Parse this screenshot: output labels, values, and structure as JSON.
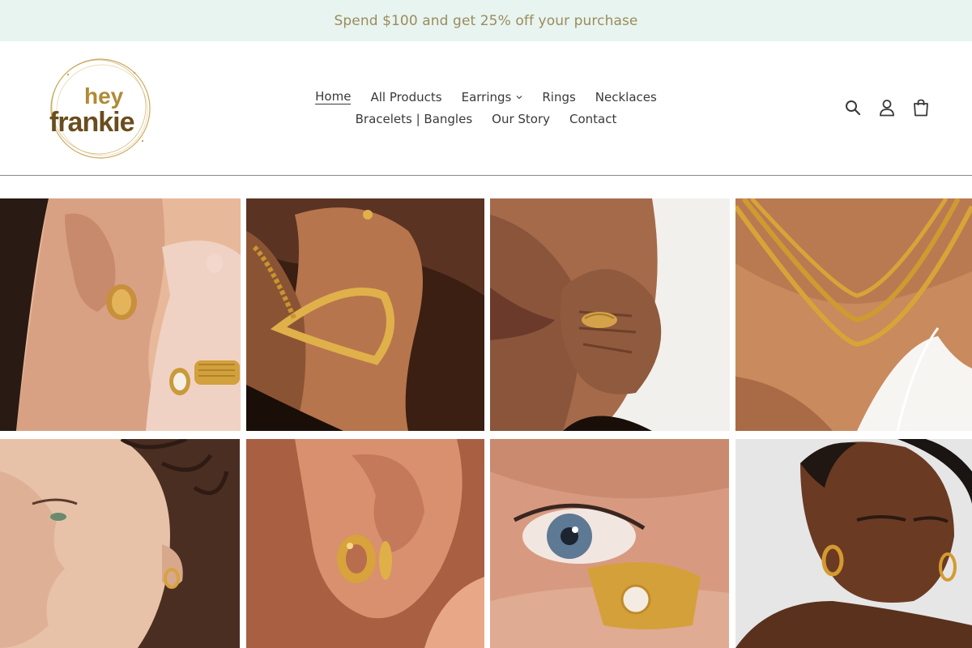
{
  "announcement": {
    "text": "Spend $100 and get 25% off your purchase"
  },
  "brand": {
    "line1": "hey",
    "line2": "frankie",
    "color": "#a07e2c"
  },
  "nav": {
    "row1": [
      {
        "label": "Home",
        "active": true
      },
      {
        "label": "All Products"
      },
      {
        "label": "Earrings",
        "dropdown": true
      },
      {
        "label": "Rings"
      },
      {
        "label": "Necklaces"
      }
    ],
    "row2": [
      {
        "label": "Bracelets | Bangles"
      },
      {
        "label": "Our Story"
      },
      {
        "label": "Contact"
      }
    ]
  },
  "header_icons": [
    "search-icon",
    "account-icon",
    "cart-icon"
  ],
  "gallery": [
    {
      "name": "hoop-earring-and-rings-photo"
    },
    {
      "name": "gold-bangle-photo"
    },
    {
      "name": "textured-ring-on-hand-photo"
    },
    {
      "name": "layered-snake-chain-necklace-photo"
    },
    {
      "name": "small-hoop-earring-profile-photo"
    },
    {
      "name": "chunky-hammered-hoop-earrings-photo"
    },
    {
      "name": "pearl-hammered-ring-eye-closeup-photo"
    },
    {
      "name": "gold-hoop-earrings-portrait-photo"
    }
  ]
}
